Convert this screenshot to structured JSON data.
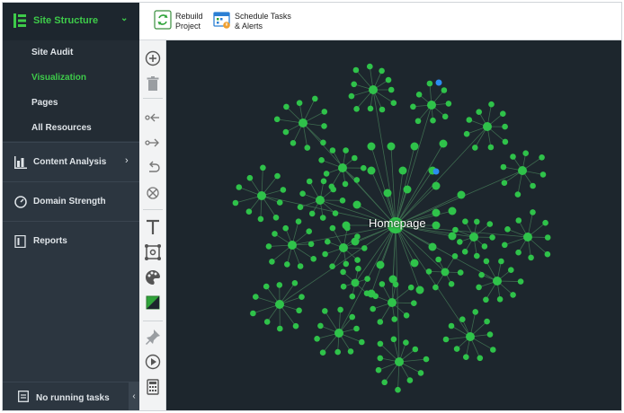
{
  "sidebar": {
    "header": {
      "label": "Site Structure",
      "icon": "site-structure-icon"
    },
    "sub_items": [
      {
        "label": "Site Audit",
        "active": false
      },
      {
        "label": "Visualization",
        "active": true
      },
      {
        "label": "Pages",
        "active": false
      },
      {
        "label": "All Resources",
        "active": false
      }
    ],
    "sections": [
      {
        "label": "Content Analysis",
        "icon": "bar-chart-icon",
        "has_chevron": true
      },
      {
        "label": "Domain Strength",
        "icon": "gauge-icon",
        "has_chevron": false
      },
      {
        "label": "Reports",
        "icon": "report-icon",
        "has_chevron": false
      }
    ],
    "footer": {
      "label": "No running tasks",
      "icon": "tasks-icon",
      "collapse_glyph": "‹"
    }
  },
  "toolbar": {
    "rebuild_label": "Rebuild\nProject",
    "schedule_label": "Schedule Tasks\n& Alerts"
  },
  "tools": [
    "add-node-icon",
    "delete-icon",
    "link-in-icon",
    "link-out-icon",
    "undo-link-icon",
    "crosshair-icon",
    "text-icon",
    "layout-icon",
    "palette-icon",
    "color-fill-icon",
    "pin-icon",
    "play-icon",
    "calculator-icon"
  ],
  "graph": {
    "center_label": "Homepage",
    "node_color": "#2fc24a",
    "highlight_color": "#2b8cf0",
    "edge_color": "#3d6a4f",
    "background": "#1d262d"
  },
  "colors": {
    "accent": "#3ecb4a",
    "sidebar_bg": "#2c3640"
  }
}
